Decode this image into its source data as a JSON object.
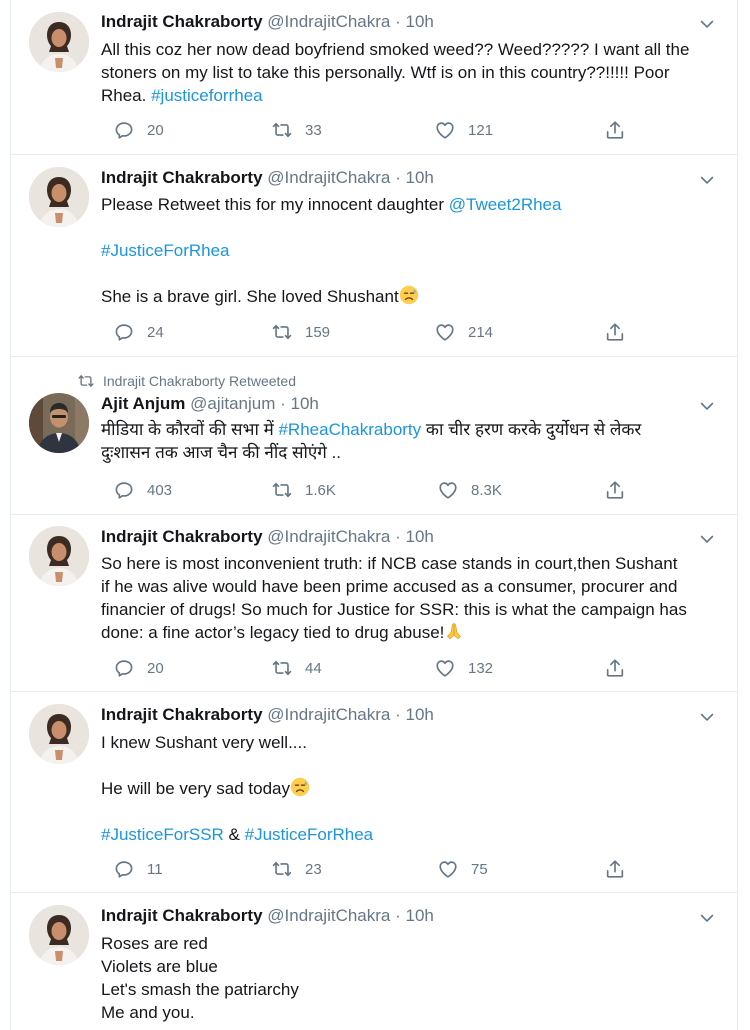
{
  "tweets": [
    {
      "name": "Indrajit Chakraborty",
      "handle": "@IndrajitChakra",
      "time": "10h",
      "lines": [
        "All this coz her now dead boyfriend smoked weed?? Weed????? I want all the",
        "stoners on my list to take this personally. Wtf is on in this country??!!!!! Poor",
        "Rhea. "
      ],
      "hashtag": "#justiceforrhea",
      "replies": "20",
      "retweets": "33",
      "likes": "121"
    },
    {
      "name": "Indrajit Chakraborty",
      "handle": "@IndrajitChakra",
      "time": "10h",
      "line1": "Please Retweet this for my innocent daughter ",
      "mention": "@Tweet2Rhea",
      "hashtag": "#JusticeForRhea",
      "line3": "She is a brave girl. She loved Shushant",
      "replies": "24",
      "retweets": "159",
      "likes": "214"
    },
    {
      "retweet_label": "Indrajit Chakraborty Retweeted",
      "name": "Ajit Anjum",
      "handle": "@ajitanjum",
      "time": "10h",
      "line1_pre": "मीडिया के कौरवों की सभा में ",
      "hashtag": "#RheaChakraborty",
      "line1_post": " का चीर हरण करके दुर्योधन से लेकर",
      "line2": "दुःशासन तक आज चैन की नींद सोएंगे ..",
      "replies": "403",
      "retweets": "1.6K",
      "likes": "8.3K"
    },
    {
      "name": "Indrajit Chakraborty",
      "handle": "@IndrajitChakra",
      "time": "10h",
      "lines": [
        "So here is most inconvenient truth: if NCB case stands in court,then Sushant",
        "if he was alive would have been prime accused as a consumer, procurer and",
        "financier of drugs! So much for Justice for SSR: this is what the campaign has",
        "done: a fine actor’s legacy tied to drug abuse!"
      ],
      "replies": "20",
      "retweets": "44",
      "likes": "132"
    },
    {
      "name": "Indrajit Chakraborty",
      "handle": "@IndrajitChakra",
      "time": "10h",
      "line1": "I knew Sushant very well....",
      "line2": "He will be very sad today",
      "hashtag1": "#JusticeForSSR",
      "amp": " & ",
      "hashtag2": "#JusticeForRhea",
      "replies": "11",
      "retweets": "23",
      "likes": "75"
    },
    {
      "name": "Indrajit Chakraborty",
      "handle": "@IndrajitChakra",
      "time": "10h",
      "lines": [
        "Roses are red",
        "Violets are blue",
        "Let's smash the patriarchy",
        "Me and you."
      ]
    }
  ],
  "icons": {
    "reply": "reply-icon",
    "retweet": "retweet-icon",
    "like": "heart-icon",
    "share": "share-icon",
    "more": "chevron-down-icon"
  },
  "colors": {
    "link": "#1b95e0",
    "meta": "#657786",
    "border": "#e6ecf0"
  }
}
